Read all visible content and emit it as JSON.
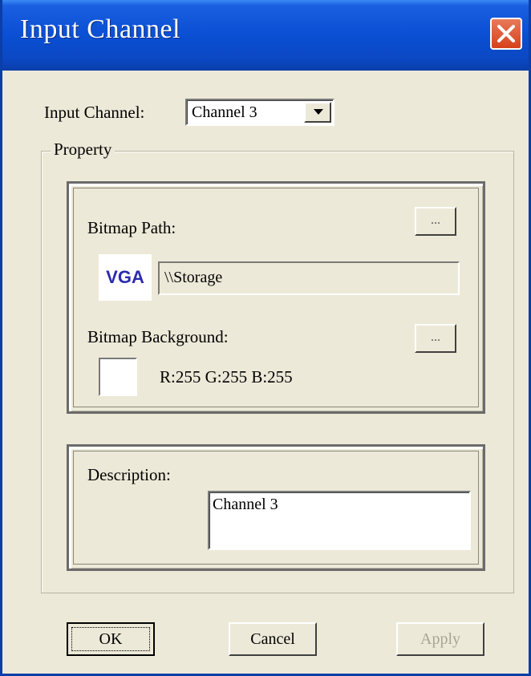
{
  "window": {
    "title": "Input Channel"
  },
  "input_channel": {
    "label": "Input Channel:",
    "selected": "Channel 3"
  },
  "property": {
    "legend": "Property",
    "bitmap_path": {
      "label": "Bitmap Path:",
      "browse_label": "...",
      "preview_text": "VGA",
      "value": "\\\\Storage"
    },
    "bitmap_background": {
      "label": "Bitmap Background:",
      "browse_label": "...",
      "color": "#FFFFFF",
      "rgb_text": "R:255  G:255  B:255"
    },
    "description": {
      "label": "Description:",
      "value": "Channel 3"
    }
  },
  "buttons": {
    "ok": "OK",
    "cancel": "Cancel",
    "apply": "Apply"
  },
  "colors": {
    "titlebar": "#0a4fd4",
    "dialog_bg": "#ece9d8",
    "close": "#d6411b"
  }
}
